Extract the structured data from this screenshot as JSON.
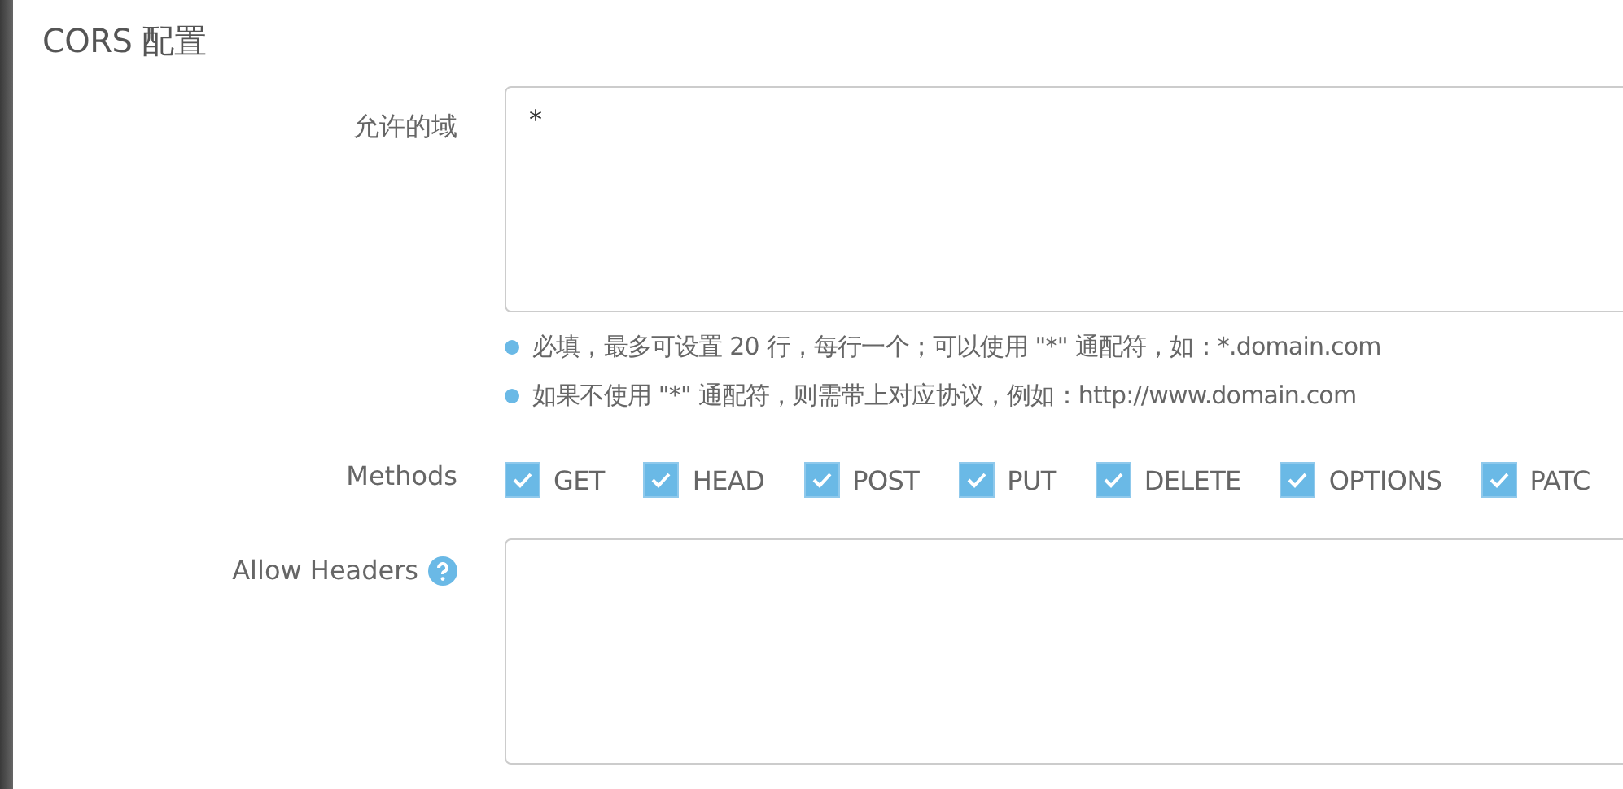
{
  "title": "CORS 配置",
  "allowed_domains": {
    "label": "允许的域",
    "value": "*"
  },
  "hints": [
    "必填，最多可设置 20 行，每行一个；可以使用 \"*\" 通配符，如：*.domain.com",
    "如果不使用 \"*\" 通配符，则需带上对应协议，例如：http://www.domain.com"
  ],
  "methods": {
    "label": "Methods",
    "options": [
      {
        "label": "GET",
        "checked": true
      },
      {
        "label": "HEAD",
        "checked": true
      },
      {
        "label": "POST",
        "checked": true
      },
      {
        "label": "PUT",
        "checked": true
      },
      {
        "label": "DELETE",
        "checked": true
      },
      {
        "label": "OPTIONS",
        "checked": true
      },
      {
        "label": "PATC",
        "checked": true
      }
    ]
  },
  "allow_headers": {
    "label": "Allow Headers"
  }
}
